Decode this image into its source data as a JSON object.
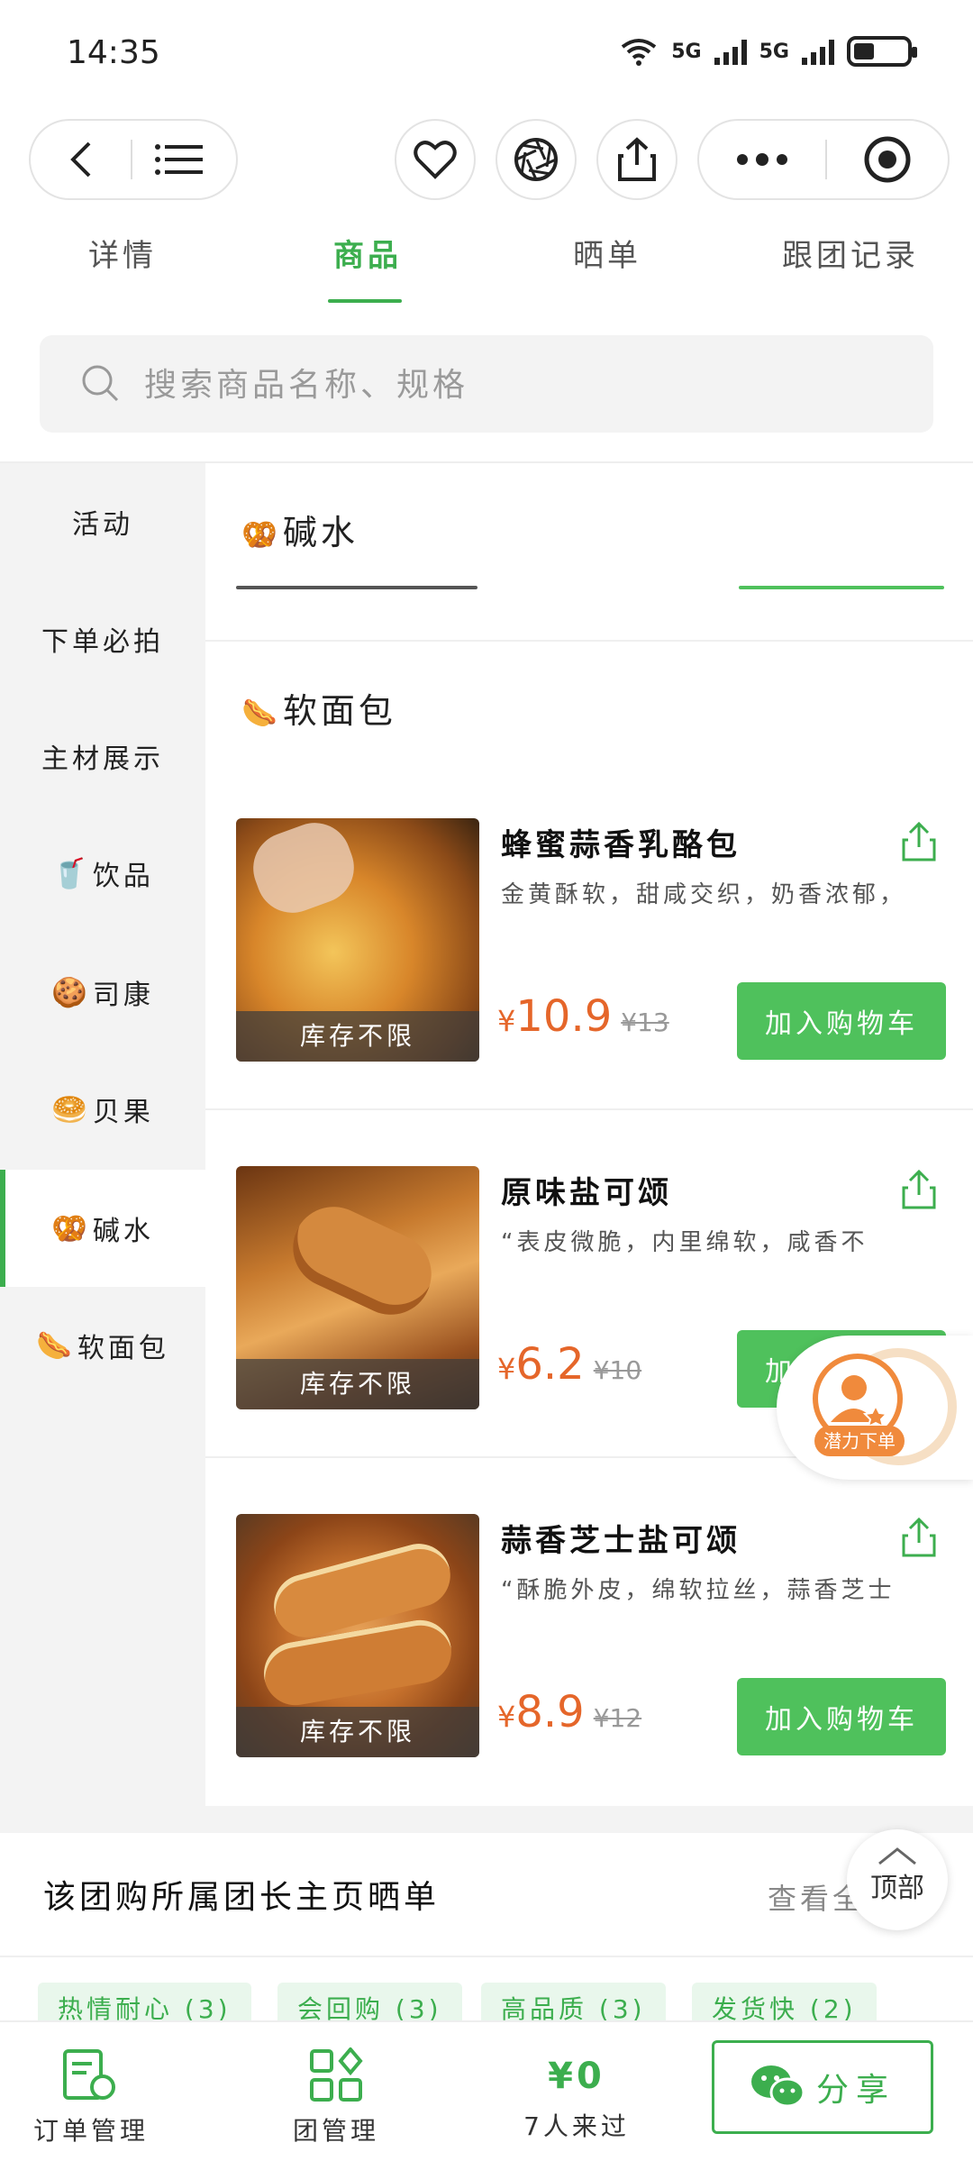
{
  "status_bar": {
    "time": "14:35",
    "network1": "5G",
    "network2": "5G"
  },
  "tabs": [
    {
      "label": "详情"
    },
    {
      "label": "商品"
    },
    {
      "label": "晒单"
    },
    {
      "label": "跟团记录"
    }
  ],
  "search": {
    "placeholder": "搜索商品名称、规格"
  },
  "sidebar": {
    "items": [
      {
        "label": "活动",
        "icon": ""
      },
      {
        "label": "下单必拍",
        "icon": ""
      },
      {
        "label": "主材展示",
        "icon": ""
      },
      {
        "label": "饮品",
        "icon": "🥤"
      },
      {
        "label": "司康",
        "icon": "🍪"
      },
      {
        "label": "贝果",
        "icon": "🥯"
      },
      {
        "label": "碱水",
        "icon": "🥨"
      },
      {
        "label": "软面包",
        "icon": "🌭"
      }
    ]
  },
  "sections": {
    "jianshui": {
      "icon": "🥨",
      "title": "碱水"
    },
    "ruanmianbao": {
      "icon": "🌭",
      "title": "软面包"
    }
  },
  "products": [
    {
      "name": "蜂蜜蒜香乳酪包",
      "desc": "金黄酥软，甜咸交织，奶香浓郁，",
      "currency": "¥",
      "price": "10.9",
      "orig": "¥13",
      "stock": "库存不限",
      "add_label": "加入购物车"
    },
    {
      "name": "原味盐可颂",
      "desc": "“表皮微脆，内里绵软，咸香不",
      "currency": "¥",
      "price": "6.2",
      "orig": "¥10",
      "stock": "库存不限",
      "add_label": "加入购物车"
    },
    {
      "name": "蒜香芝士盐可颂",
      "desc": "“酥脆外皮，绵软拉丝，蒜香芝士",
      "currency": "¥",
      "price": "8.9",
      "orig": "¥12",
      "stock": "库存不限",
      "add_label": "加入购物车"
    }
  ],
  "float_badge": {
    "label": "潜力下单"
  },
  "top_button": {
    "label": "顶部"
  },
  "leader_section": {
    "title": "该团购所属团长主页晒单",
    "more": "查看全"
  },
  "tags": [
    {
      "label": "热情耐心 (3)"
    },
    {
      "label": "会回购 (3)"
    },
    {
      "label": "高品质 (3)"
    },
    {
      "label": "发货快 (2)"
    }
  ],
  "bottom_bar": {
    "orders": "订单管理",
    "group": "团管理",
    "amount": "¥0",
    "visitors": "7人来过",
    "share": "分享"
  },
  "colors": {
    "accent": "#3cae4e",
    "button": "#4fc15c",
    "price": "#e5662a"
  }
}
